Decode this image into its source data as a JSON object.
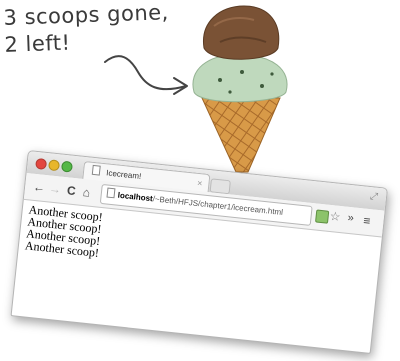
{
  "annotation": {
    "line1": "3 scoops gone,",
    "line2": "2 left!"
  },
  "browser": {
    "tab_title": "Icecream!",
    "tab_close": "×",
    "resize_glyph": "⤢",
    "nav": {
      "back": "←",
      "forward": "→",
      "reload": "C",
      "home": "⌂"
    },
    "address": {
      "host": "localhost",
      "path": "/~Beth/HFJS/chapter1/icecream.html"
    },
    "star": "☆",
    "more": "»",
    "menu": "≡"
  },
  "page_lines": [
    "Another scoop!",
    "Another scoop!",
    "Another scoop!",
    "Another scoop!"
  ],
  "colors": {
    "close_dot": "#e3463f",
    "minimize_dot": "#e8b62b",
    "zoom_dot": "#54b847",
    "scoop_chocolate": "#7a5235",
    "scoop_mint": "#bfd9bd",
    "cone": "#d89a48"
  }
}
